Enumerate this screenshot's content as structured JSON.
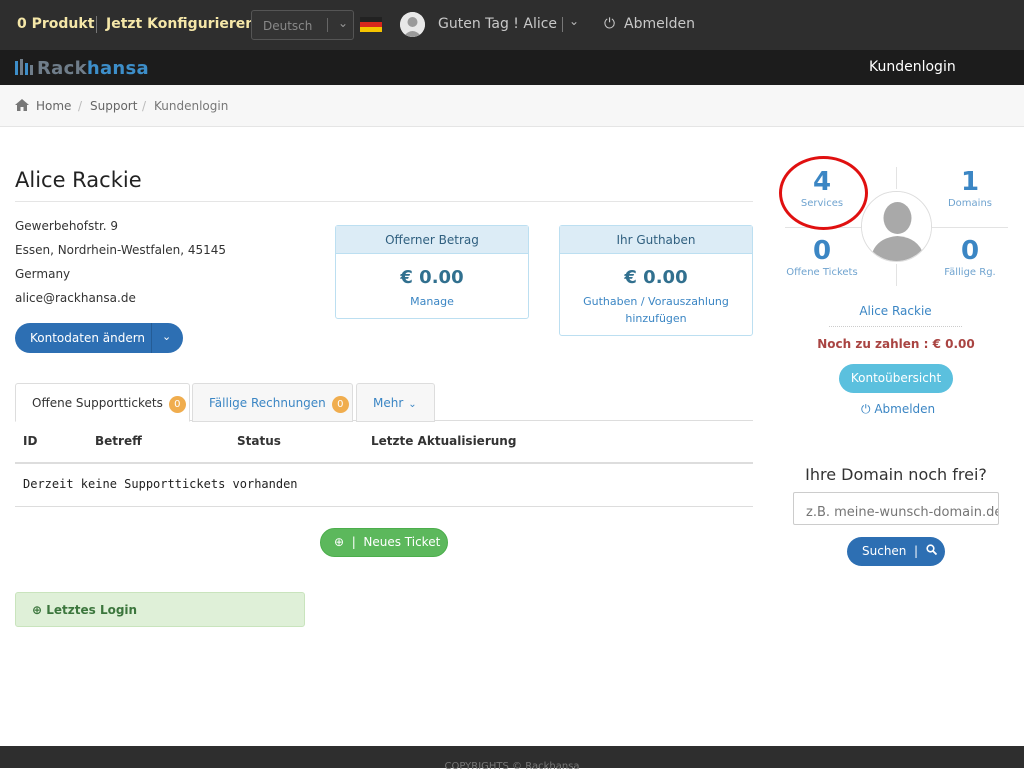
{
  "topbar": {
    "products": "0 Produkt",
    "configure": "Jetzt Konfigurieren",
    "language": "Deutsch",
    "greeting": "Guten Tag ! Alice",
    "logout": "Abmelden"
  },
  "navbar": {
    "logo_part1": "Rack",
    "logo_part2": "hansa",
    "customer_login": "Kundenlogin"
  },
  "breadcrumb": {
    "home": "Home",
    "support": "Support",
    "current": "Kundenlogin"
  },
  "account": {
    "name": "Alice Rackie",
    "street": "Gewerbehofstr. 9",
    "city": "Essen, Nordrhein-Westfalen, 45145",
    "country": "Germany",
    "email": "alice@rackhansa.de",
    "edit_button": "Kontodaten ändern"
  },
  "panels": {
    "open_amount_title": "Offerner Betrag",
    "open_amount_value": "€ 0.00",
    "open_amount_link": "Manage",
    "credit_title": "Ihr Guthaben",
    "credit_value": "€ 0.00",
    "credit_link_line1": "Guthaben / Vorauszahlung",
    "credit_link_line2": "hinzufügen"
  },
  "tabs": [
    {
      "label": "Offene Supporttickets",
      "badge": "0"
    },
    {
      "label": "Fällige Rechnungen",
      "badge": "0"
    },
    {
      "label": "Mehr"
    }
  ],
  "table": {
    "columns": [
      "ID",
      "Betreff",
      "Status",
      "Letzte Aktualisierung"
    ],
    "empty_message": "Derzeit keine Supporttickets vorhanden"
  },
  "new_ticket_button": "Neues Ticket",
  "last_login": "Letztes Login",
  "stats": {
    "services_count": "4",
    "services_label": "Services",
    "domains_count": "1",
    "domains_label": "Domains",
    "tickets_count": "0",
    "tickets_label": "Offene Tickets",
    "invoices_count": "0",
    "invoices_label": "Fällige Rg."
  },
  "sidebar": {
    "name": "Alice Rackie",
    "due": "Noch zu zahlen : € 0.00",
    "overview_button": "Kontoübersicht",
    "logout": "Abmelden"
  },
  "domain_check": {
    "question": "Ihre Domain noch frei?",
    "placeholder": "z.B. meine-wunsch-domain.de",
    "search_button": "Suchen"
  },
  "footer": {
    "text": "COPYRIGHTS © Rackhansa"
  },
  "colors": {
    "topbar": "#2e2e2e",
    "primary": "#2d6fb3",
    "success": "#5cb85c",
    "info": "#5bc0de",
    "highlight_circle": "#e01010"
  }
}
